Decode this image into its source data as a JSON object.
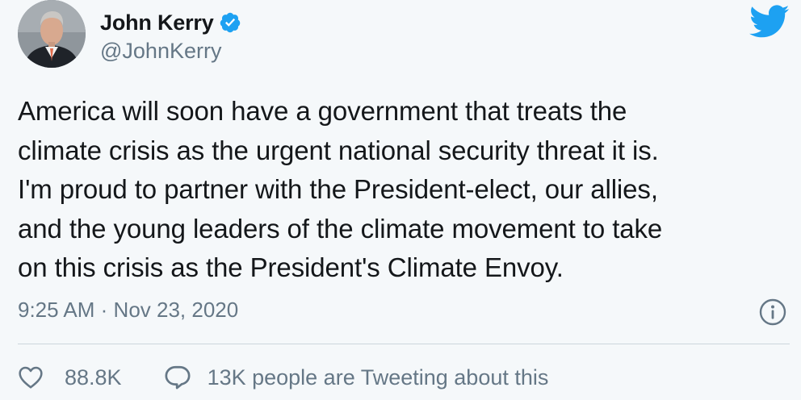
{
  "author": {
    "display_name": "John Kerry",
    "handle": "@JohnKerry",
    "verified": true,
    "avatar_icon": "profile-photo"
  },
  "tweet": {
    "text": "America will soon have a government that treats the climate crisis as the urgent national security threat it is. I'm proud to partner with the President-elect, our allies, and the young leaders of the climate movement to take on this crisis as the President's Climate Envoy.",
    "lines": [
      "America will soon have a government that treats the",
      "climate crisis as the urgent national security threat it is.",
      "I'm proud to partner with the President-elect, our allies,",
      "and the young leaders of the climate movement to take",
      "on this crisis as the President's Climate Envoy."
    ],
    "time": "9:25 AM",
    "separator": "·",
    "date": "Nov 23, 2020"
  },
  "actions": {
    "like_count": "88.8K",
    "conversation_text": "13K people are Tweeting about this"
  },
  "icons": {
    "brand": "twitter-bird-icon",
    "verified": "verified-badge-icon",
    "info": "info-icon",
    "like": "heart-icon",
    "reply": "speech-bubble-icon"
  },
  "colors": {
    "brand_blue": "#1da1f2",
    "text": "#14171a",
    "secondary_text": "#657786",
    "background": "#f5f8fa",
    "divider": "#ccd6dd"
  }
}
